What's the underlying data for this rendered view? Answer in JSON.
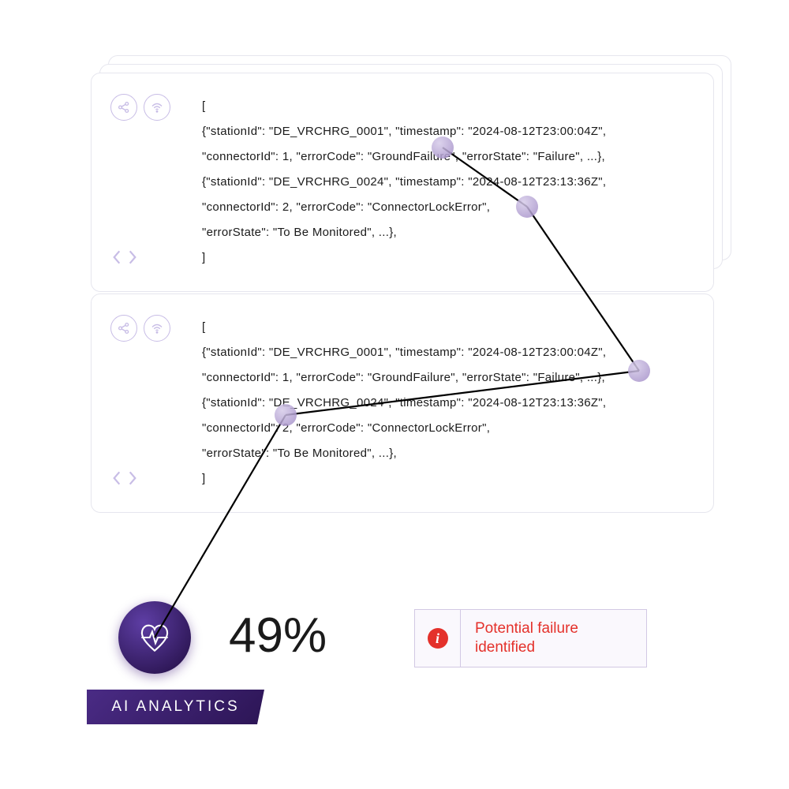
{
  "cards": [
    {
      "lines": [
        "[",
        "{\"stationId\": \"DE_VRCHRG_0001\", \"timestamp\": \"2024-08-12T23:00:04Z\",",
        "\"connectorId\": 1, \"errorCode\": \"GroundFailure\", \"errorState\": \"Failure\", ...},",
        "{\"stationId\": \"DE_VRCHRG_0024\", \"timestamp\": \"2024-08-12T23:13:36Z\",",
        "\"connectorId\": 2, \"errorCode\": \"ConnectorLockError\",",
        "\"errorState\": \"To Be Monitored\", ...},",
        "]"
      ]
    },
    {
      "lines": [
        "[",
        "{\"stationId\": \"DE_VRCHRG_0001\", \"timestamp\": \"2024-08-12T23:00:04Z\",",
        "\"connectorId\": 1, \"errorCode\": \"GroundFailure\", \"errorState\": \"Failure\", ...},",
        "{\"stationId\": \"DE_VRCHRG_0024\", \"timestamp\": \"2024-08-12T23:13:36Z\",",
        "\"connectorId\": 2, \"errorCode\": \"ConnectorLockError\",",
        "\"errorState\": \"To Be Monitored\", ...},",
        "]"
      ]
    }
  ],
  "analytics": {
    "label": "AI ANALYTICS",
    "percent": "49%"
  },
  "warning": {
    "icon_glyph": "i",
    "line1": "Potential failure",
    "line2": "identified"
  }
}
